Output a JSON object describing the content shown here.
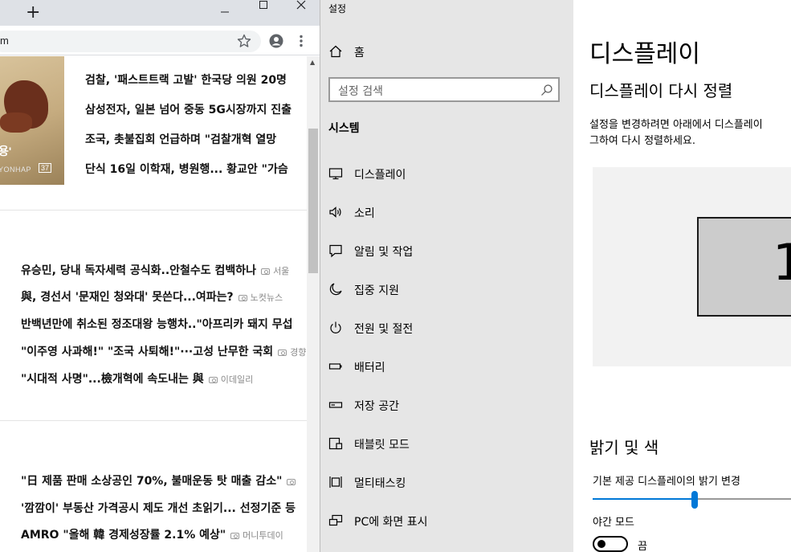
{
  "browser": {
    "new_tab_glyph": "+",
    "url_text": "m",
    "photo": {
      "caption": "용'",
      "credit": "YONHAP",
      "count": "37"
    },
    "top_headlines": [
      "검찰, '패스트트랙 고발' 한국당 의원 20명",
      "삼성전자, 일본 넘어 중동 5G시장까지 진출",
      "조국, 촛불집회 언급하며 \"검찰개혁 열망 ",
      "단식 16일 이학재, 병원행... 황교안 \"가슴 "
    ],
    "group2": [
      {
        "title": "유승민, 당내 독자세력 공식화..안철수도 컴백하나",
        "source": "서울"
      },
      {
        "title": "與, 경선서 '문재인 청와대' 못쓴다...여파는?",
        "source": "노컷뉴스"
      },
      {
        "title": "반백년만에 취소된 정조대왕 능행차..\"아프리카 돼지 무섭",
        "source": ""
      },
      {
        "title": "\"이주영 사과해!\" \"조국 사퇴해!\"···고성 난무한 국회",
        "source": "경향"
      },
      {
        "title": "\"시대적 사명\"...檢개혁에 속도내는 與",
        "source": "이데일리"
      }
    ],
    "group3": [
      {
        "title": "\"日 제품 판매 소상공인 70%, 불매운동 탓 매출 감소\"",
        "source": ""
      },
      {
        "title": "'깜깜이' 부동산 가격공시 제도 개선 초읽기... 선정기준 등",
        "source": ""
      },
      {
        "title": "AMRO \"올해 韓 경제성장률 2.1% 예상\"",
        "source": "머니투데이"
      }
    ]
  },
  "settings": {
    "window_title": "설정",
    "home_label": "홈",
    "search_placeholder": "설정 검색",
    "section_label": "시스템",
    "nav_items": [
      {
        "label": "디스플레이",
        "icon": "monitor-icon"
      },
      {
        "label": "소리",
        "icon": "speaker-icon"
      },
      {
        "label": "알림 및 작업",
        "icon": "notification-icon"
      },
      {
        "label": "집중 지원",
        "icon": "moon-icon"
      },
      {
        "label": "전원 및 절전",
        "icon": "power-icon"
      },
      {
        "label": "배터리",
        "icon": "battery-icon"
      },
      {
        "label": "저장 공간",
        "icon": "storage-icon"
      },
      {
        "label": "태블릿 모드",
        "icon": "tablet-icon"
      },
      {
        "label": "멀티태스킹",
        "icon": "multitasking-icon"
      },
      {
        "label": "PC에 화면 표시",
        "icon": "project-icon"
      }
    ],
    "content": {
      "title": "디스플레이",
      "rearrange_heading": "디스플레이 다시 정렬",
      "rearrange_desc_line1": "설정을 변경하려면 아래에서 디스플레이",
      "rearrange_desc_line2": "그하여 다시 정렬하세요.",
      "monitor_number": "1",
      "brightness_heading": "밝기 및 색",
      "brightness_label": "기본 제공 디스플레이의 밝기 변경",
      "brightness_value": 0.49,
      "night_mode_label": "야간 모드",
      "night_mode_state": "끔"
    },
    "accent_color": "#0078d7"
  }
}
